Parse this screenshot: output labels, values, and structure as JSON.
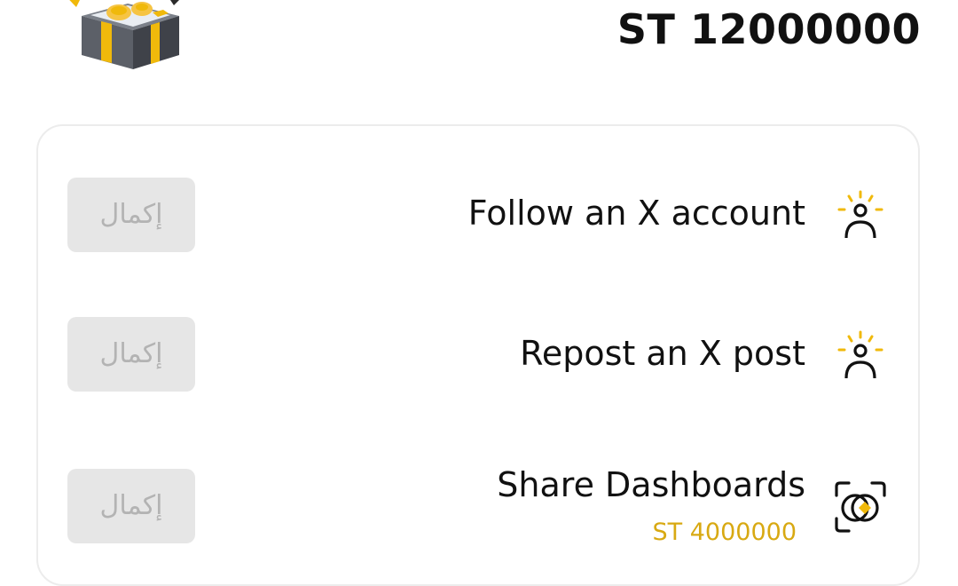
{
  "header": {
    "balance": "ST 12000000"
  },
  "tasks": [
    {
      "title": "Follow an X account",
      "button_label": "إكمال",
      "icon": "user-sparkle-icon"
    },
    {
      "title": "Repost an X post",
      "button_label": "إكمال",
      "icon": "user-sparkle-icon"
    },
    {
      "title": "Share Dashboards",
      "reward": "ST 4000000",
      "button_label": "إكمال",
      "icon": "share-coin-icon"
    }
  ],
  "colors": {
    "accent": "#F0B90B",
    "reward_text": "#D8A912",
    "button_bg": "#E6E6E6",
    "button_text": "#B3B3B3"
  }
}
